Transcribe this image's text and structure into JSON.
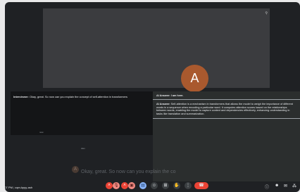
{
  "tile": {
    "avatar_letter": "A",
    "pin_icon": "pin-icon"
  },
  "interviewer": {
    "label": "Interviewer:",
    "text": "Okay, great. So now can you explain the concept of self-attention in transformers",
    "footer": "now"
  },
  "ai": {
    "header": "AI Answer: I am here.",
    "answer_label": "AI Answer:",
    "answer_text": "Self-attention is a mechanism in transformers that allows the model to weigh the importance of different words in a sequence when encoding a particular word. It computes attention scores based on the relationships between words, enabling the model to capture context and dependencies effectively, enhancing understanding in tasks like translation and summarization."
  },
  "speaker": {
    "name": "Alex",
    "avatar_letter": "A"
  },
  "caption": {
    "text": "Okay, great. So now can you explain the co"
  },
  "status": {
    "time": "1:07 PM",
    "meeting_code": "cqm-kpyy-ash"
  },
  "controls": {
    "mic_icon": "mic-off-icon",
    "cam_icon": "camera-off-icon",
    "captions_icon": "captions-icon",
    "emoji_icon": "emoji-icon",
    "present_icon": "present-icon",
    "hand_icon": "raise-hand-icon",
    "more_icon": "more-icon",
    "end_icon": "end-call-icon"
  },
  "colors": {
    "accent_red": "#ea4335",
    "avatar": "#a9592e",
    "blue": "#8ab4f8"
  }
}
